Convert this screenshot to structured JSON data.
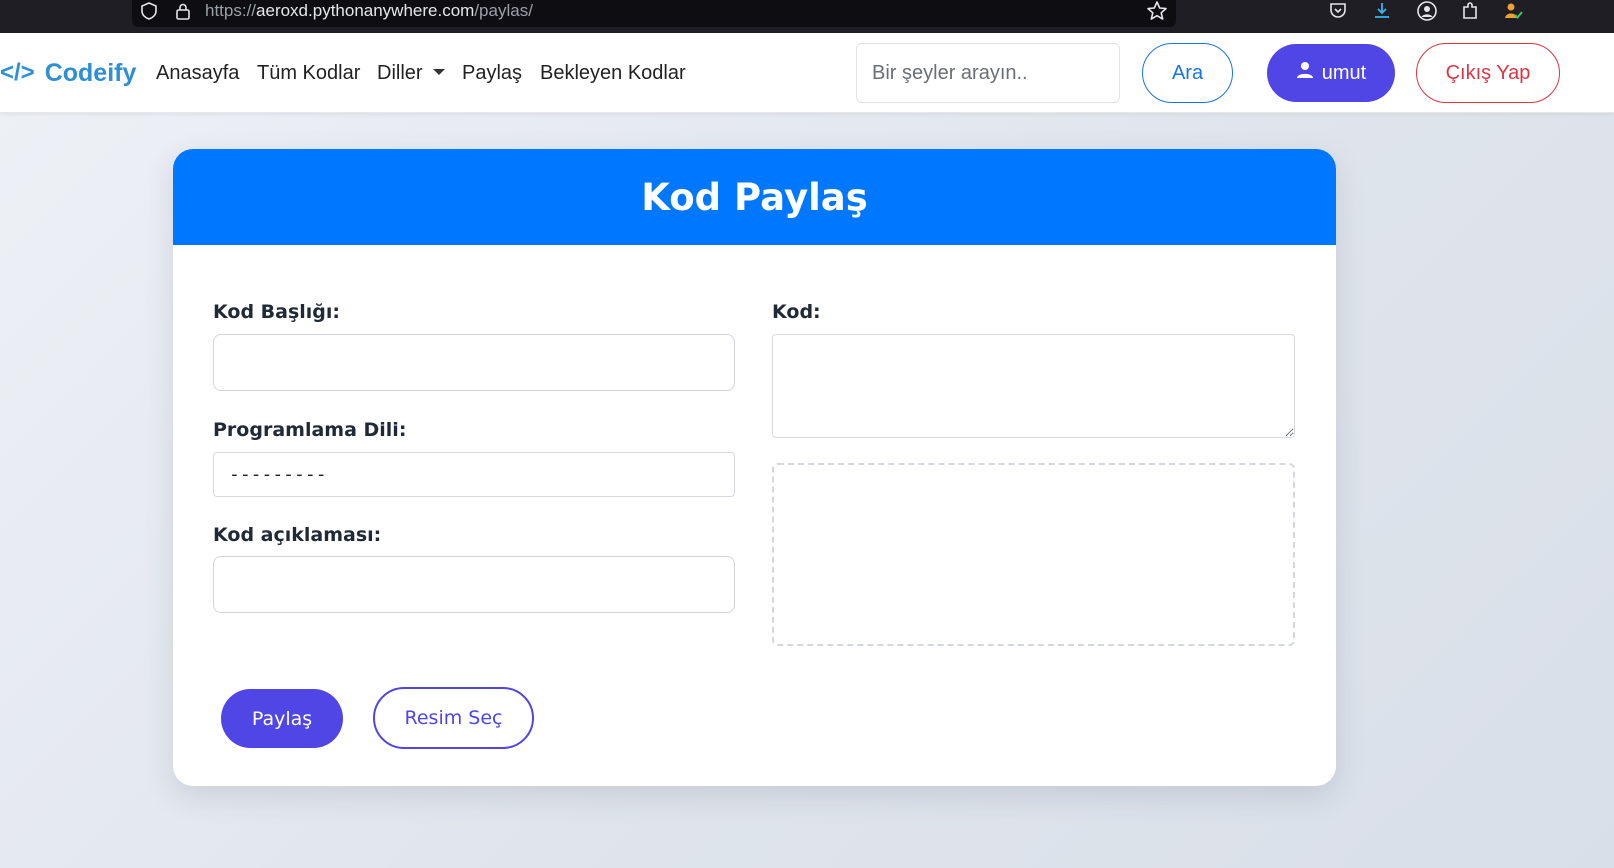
{
  "browser": {
    "url_prefix": "https://",
    "url_domain": "aeroxd.pythonanywhere.com",
    "url_path": "/paylas/"
  },
  "navbar": {
    "brand_icon": "</>",
    "brand": "Codeify",
    "links": [
      "Anasayfa",
      "Tüm Kodlar",
      "Diller",
      "Paylaş",
      "Bekleyen Kodlar"
    ],
    "search_placeholder": "Bir şeyler arayın..",
    "search_button": "Ara",
    "user_button": "umut",
    "logout_button": "Çıkış Yap"
  },
  "form": {
    "title": "Kod Paylaş",
    "title_label": "Kod Başlığı:",
    "language_label": "Programlama Dili:",
    "language_selected": "---------",
    "description_label": "Kod açıklaması:",
    "code_label": "Kod:",
    "submit_button": "Paylaş",
    "image_button": "Resim Seç"
  },
  "colors": {
    "accent": "#0077ff",
    "brand": "#2d8fd5",
    "primary_button": "#4f46e5",
    "danger": "#dc3545"
  }
}
